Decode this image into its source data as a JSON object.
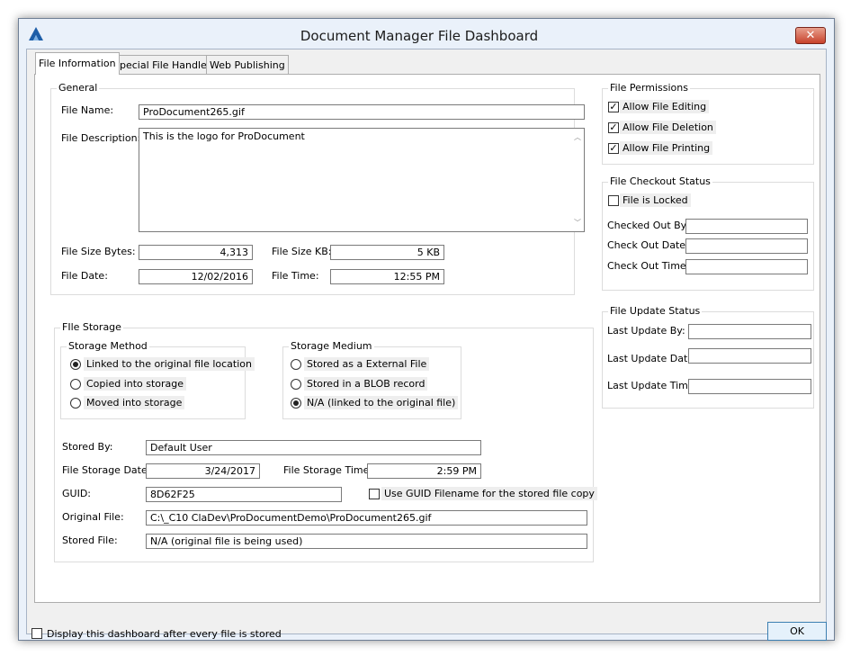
{
  "window": {
    "title": "Document Manager File Dashboard",
    "close_glyph": "✕"
  },
  "tabs": [
    {
      "label": "File Information"
    },
    {
      "label": "Special File Handlers"
    },
    {
      "label": "Web Publishing"
    }
  ],
  "general": {
    "title": "General",
    "file_name_label": "File Name:",
    "file_name": "ProDocument265.gif",
    "file_description_label": "File Description:",
    "file_description": "This is the logo for ProDocument",
    "file_size_bytes_label": "File Size Bytes:",
    "file_size_bytes": "4,313",
    "file_size_kb_label": "File Size KB:",
    "file_size_kb": "5 KB",
    "file_date_label": "File Date:",
    "file_date": "12/02/2016",
    "file_time_label": "File Time:",
    "file_time": "12:55 PM"
  },
  "file_storage": {
    "title": "FIle Storage",
    "storage_method": {
      "title": "Storage Method",
      "options": [
        {
          "label": "Linked to the original file location",
          "selected": true
        },
        {
          "label": "Copied into storage",
          "selected": false
        },
        {
          "label": "Moved into storage",
          "selected": false
        }
      ]
    },
    "storage_medium": {
      "title": "Storage Medium",
      "options": [
        {
          "label": "Stored as a External File",
          "selected": false
        },
        {
          "label": "Stored in a BLOB record",
          "selected": false
        },
        {
          "label": "N/A (linked to the original file)",
          "selected": true
        }
      ]
    },
    "stored_by_label": "Stored By:",
    "stored_by": "Default User",
    "storage_date_label": "File Storage Date:",
    "storage_date": "3/24/2017",
    "storage_time_label": "File Storage Time:",
    "storage_time": "2:59 PM",
    "guid_label": "GUID:",
    "guid": "8D62F25",
    "use_guid_label": "Use GUID Filename for the stored file copy",
    "use_guid_checked": false,
    "original_file_label": "Original File:",
    "original_file": "C:\\_C10 ClaDev\\ProDocumentDemo\\ProDocument265.gif",
    "stored_file_label": "Stored File:",
    "stored_file": "N/A (original file is being used)"
  },
  "permissions": {
    "title": "File Permissions",
    "items": [
      {
        "label": "Allow File Editing",
        "checked": true
      },
      {
        "label": "Allow File Deletion",
        "checked": true
      },
      {
        "label": "Allow File Printing",
        "checked": true
      }
    ]
  },
  "checkout": {
    "title": "File Checkout Status",
    "locked_label": "File is Locked",
    "locked": false,
    "checked_out_by_label": "Checked Out By:",
    "checked_out_by": "",
    "check_out_date_label": "Check Out Date:",
    "check_out_date": "",
    "check_out_time_label": "Check Out Time:",
    "check_out_time": ""
  },
  "update": {
    "title": "File Update Status",
    "last_update_by_label": "Last Update By:",
    "last_update_by": "",
    "last_update_date_label": "Last Update Date:",
    "last_update_date": "",
    "last_update_time_label": "Last Update Time:",
    "last_update_time": ""
  },
  "footer": {
    "display_dashboard_label": "Display this dashboard after every file is stored",
    "display_dashboard_checked": false,
    "ok_label": "OK"
  }
}
